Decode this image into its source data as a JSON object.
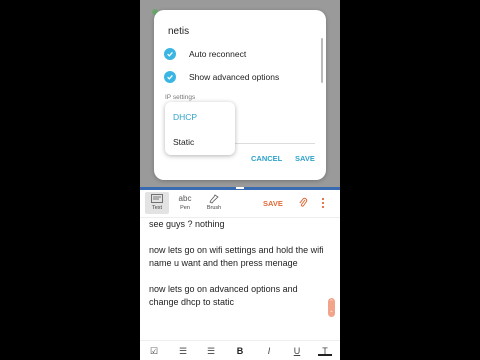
{
  "dialog": {
    "title": "netis",
    "options": [
      {
        "label": "Auto reconnect",
        "checked": true
      },
      {
        "label": "Show advanced options",
        "checked": true
      }
    ],
    "ip_settings_label": "IP settings",
    "ip_options": [
      "DHCP",
      "Static"
    ],
    "ip_selected": "DHCP",
    "cancel_label": "CANCEL",
    "save_label": "SAVE"
  },
  "notes": {
    "tools": [
      {
        "label": "Text",
        "icon": "text-icon"
      },
      {
        "label": "Pen",
        "icon": "pen-icon",
        "glyph": "abc"
      },
      {
        "label": "Brush",
        "icon": "brush-icon"
      }
    ],
    "save_label": "SAVE",
    "lines": [
      "see guys ? nothing",
      "now lets go on wifi settings and hold the wifi name u want and then press menage",
      "now lets go on advanced options and change dhcp to static"
    ],
    "format_icons": [
      "checkbox-icon",
      "bullet-list-icon",
      "numbered-list-icon",
      "bold-icon",
      "italic-icon",
      "underline-icon",
      "text-color-icon"
    ]
  },
  "colors": {
    "accent": "#3bb6e3",
    "note_accent": "#e06a3a",
    "divider": "#3a6bb0"
  }
}
